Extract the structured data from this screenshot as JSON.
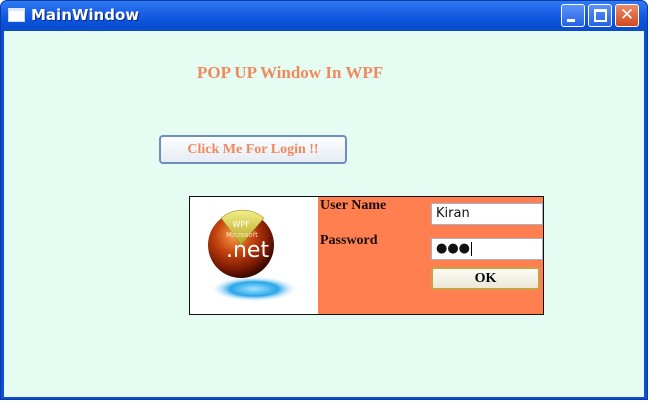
{
  "window": {
    "title": "MainWindow",
    "controls": {
      "minimize_icon": "minimize-icon",
      "maximize_icon": "maximize-icon",
      "close_icon": "close-icon",
      "close_glyph": "✕"
    }
  },
  "main": {
    "heading": "POP UP Window In WPF",
    "login_button": "Click Me For Login !!"
  },
  "popup": {
    "logo": {
      "label": "WPF",
      "text": ".net",
      "sub": "Microsoft"
    },
    "username_label": "User Name",
    "username_value": "Kiran",
    "password_label": "Password",
    "password_value": "●●●",
    "ok_label": "OK"
  },
  "colors": {
    "client_bg": "#e4fcf2",
    "accent": "#f08a5d",
    "form_bg": "#ff7f50",
    "titlebar": "#0a52db"
  }
}
